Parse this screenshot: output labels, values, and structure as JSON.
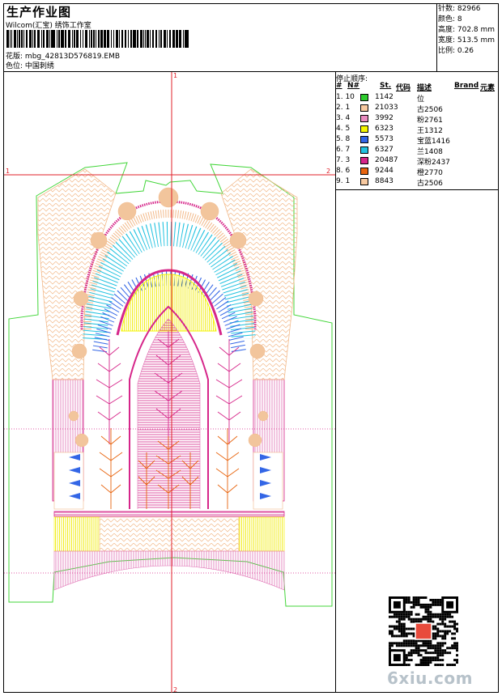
{
  "header": {
    "title": "生产作业图",
    "studio": "Wilcom(汇宝) 绣饰工作室",
    "filename_label": "花版:",
    "filename": "mbg_42813D576819.EMB",
    "colorway_label": "色位:",
    "colorway": "中国刺绣"
  },
  "stats": {
    "stitches": "针数: 82966",
    "colors": "颜色: 8",
    "height": "高度: 702.8 mm",
    "width": "宽度: 513.5 mm",
    "scale": "比例: 0.26"
  },
  "sequence": {
    "title": "停止顺序:",
    "headers": {
      "num": "#",
      "n": "N#",
      "st": "St.",
      "code": "代码",
      "desc": "描述",
      "brand": "Brand",
      "element": "元素"
    },
    "rows": [
      {
        "no": "1. 10",
        "color": "#2ecc2e",
        "stitches": "1142",
        "desc": "位"
      },
      {
        "no": "2. 1",
        "color": "#f7c9a0",
        "stitches": "21033",
        "desc": "古2506"
      },
      {
        "no": "3. 4",
        "color": "#e98cc0",
        "stitches": "3992",
        "desc": "粉2761"
      },
      {
        "no": "4. 5",
        "color": "#f5f500",
        "stitches": "6323",
        "desc": "王1312"
      },
      {
        "no": "5. 8",
        "color": "#3366e6",
        "stitches": "5573",
        "desc": "宝蓝1416"
      },
      {
        "no": "6. 7",
        "color": "#22c2e0",
        "stitches": "6327",
        "desc": "兰1408"
      },
      {
        "no": "7. 3",
        "color": "#d6268a",
        "stitches": "20487",
        "desc": "深粉2437"
      },
      {
        "no": "8. 6",
        "color": "#e8640e",
        "stitches": "9244",
        "desc": "橙2770"
      },
      {
        "no": "9. 1",
        "color": "#f7c9a0",
        "stitches": "8843",
        "desc": "古2506"
      }
    ]
  },
  "guides": {
    "top": "1",
    "bottom": "2",
    "left": "1",
    "right": "2"
  },
  "watermark": "6xiu.com"
}
